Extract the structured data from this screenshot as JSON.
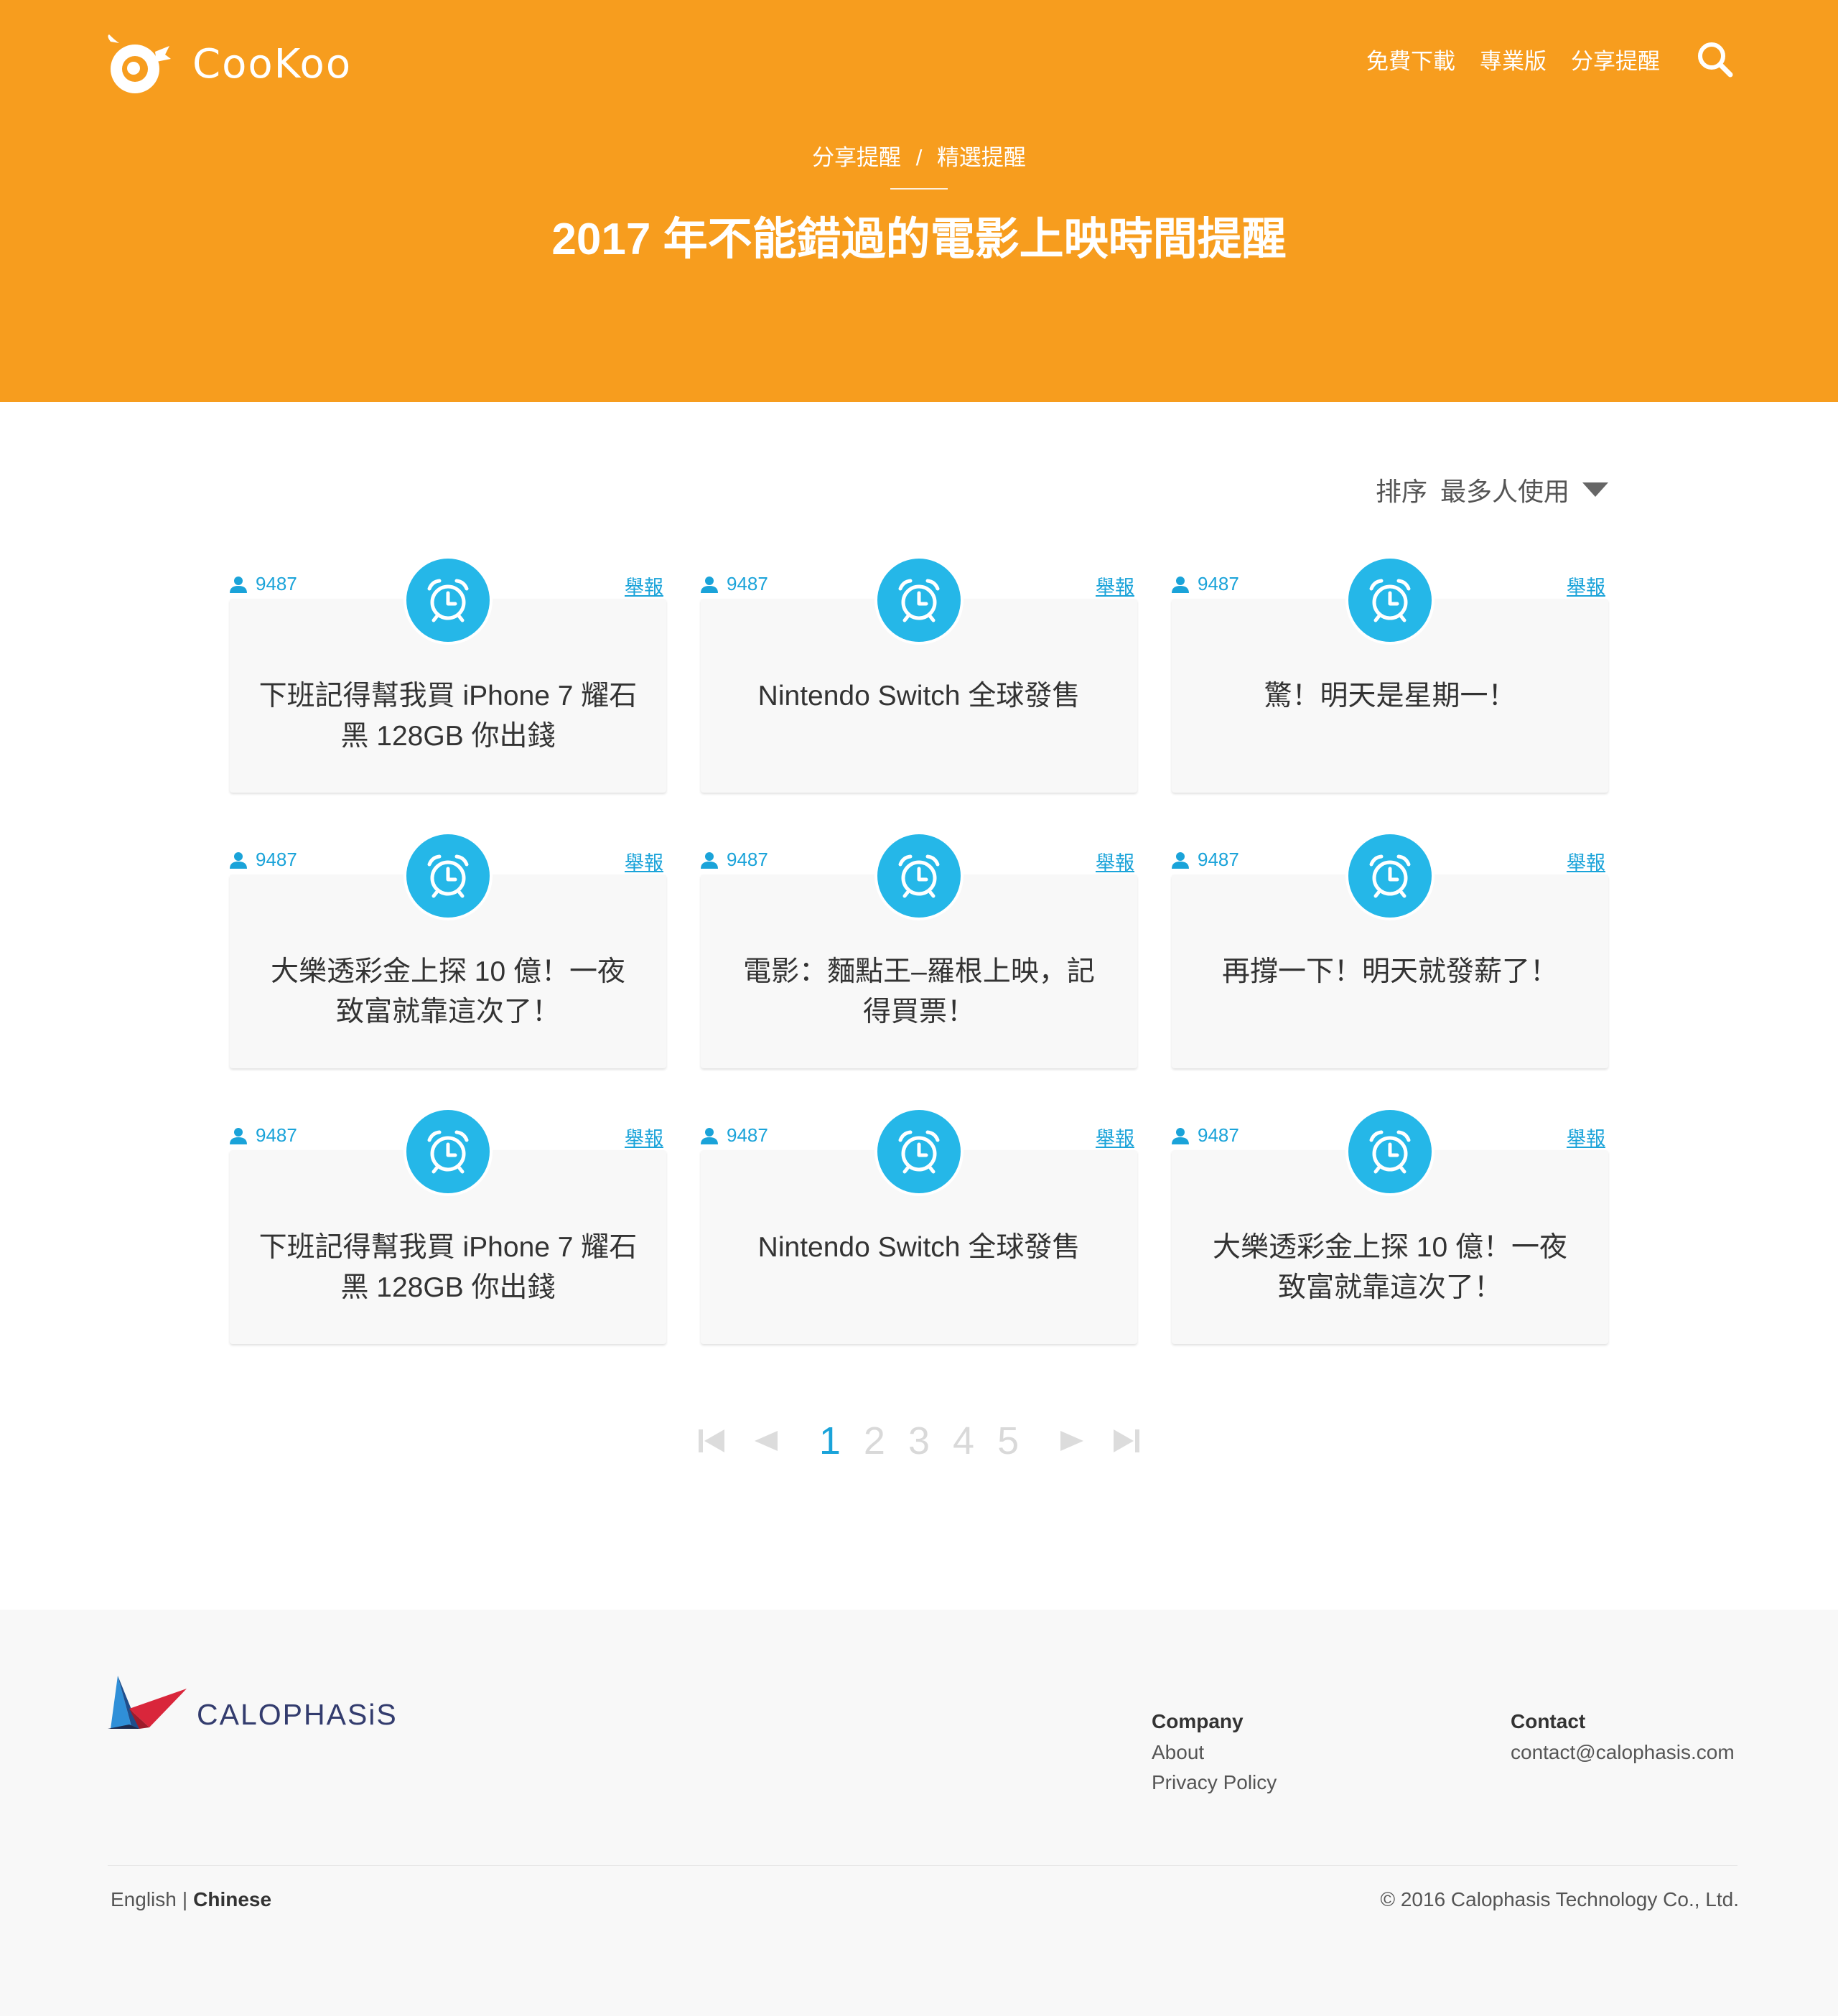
{
  "header": {
    "logo_text": "CooKoo",
    "nav": [
      "免費下載",
      "專業版",
      "分享提醒"
    ],
    "search_icon": "search-icon",
    "breadcrumb": {
      "parent": "分享提醒",
      "separator": "/",
      "current": "精選提醒"
    },
    "title": "2017 年不能錯過的電影上映時間提醒"
  },
  "sort": {
    "label": "排序",
    "value": "最多人使用"
  },
  "cards": [
    {
      "users": "9487",
      "report": "舉報",
      "title": "下班記得幫我買 iPhone 7 耀石黑 128GB 你出錢"
    },
    {
      "users": "9487",
      "report": "舉報",
      "title": "Nintendo Switch 全球發售"
    },
    {
      "users": "9487",
      "report": "舉報",
      "title": "驚！明天是星期一！"
    },
    {
      "users": "9487",
      "report": "舉報",
      "title": "大樂透彩金上探 10 億！一夜致富就靠這次了！"
    },
    {
      "users": "9487",
      "report": "舉報",
      "title": "電影：麵點王–羅根上映，記得買票！"
    },
    {
      "users": "9487",
      "report": "舉報",
      "title": "再撐一下！明天就發薪了！"
    },
    {
      "users": "9487",
      "report": "舉報",
      "title": "下班記得幫我買 iPhone 7 耀石黑 128GB 你出錢"
    },
    {
      "users": "9487",
      "report": "舉報",
      "title": "Nintendo Switch 全球發售"
    },
    {
      "users": "9487",
      "report": "舉報",
      "title": "大樂透彩金上探 10 億！一夜致富就靠這次了！"
    }
  ],
  "pagination": {
    "pages": [
      "1",
      "2",
      "3",
      "4",
      "5"
    ],
    "current": "1"
  },
  "footer": {
    "brand": "CALOPHASiS",
    "company": {
      "heading": "Company",
      "links": [
        "About",
        "Privacy Policy"
      ]
    },
    "contact": {
      "heading": "Contact",
      "email": "contact@calophasis.com"
    },
    "languages": {
      "english": "English",
      "separator": "|",
      "chinese": "Chinese"
    },
    "copyright": "© 2016 Calophasis Technology Co., Ltd."
  },
  "colors": {
    "header_bg": "#f79d1e",
    "accent": "#1aa3d9",
    "clock_bg": "#25b7e8",
    "footer_bg": "#f8f8f8"
  }
}
